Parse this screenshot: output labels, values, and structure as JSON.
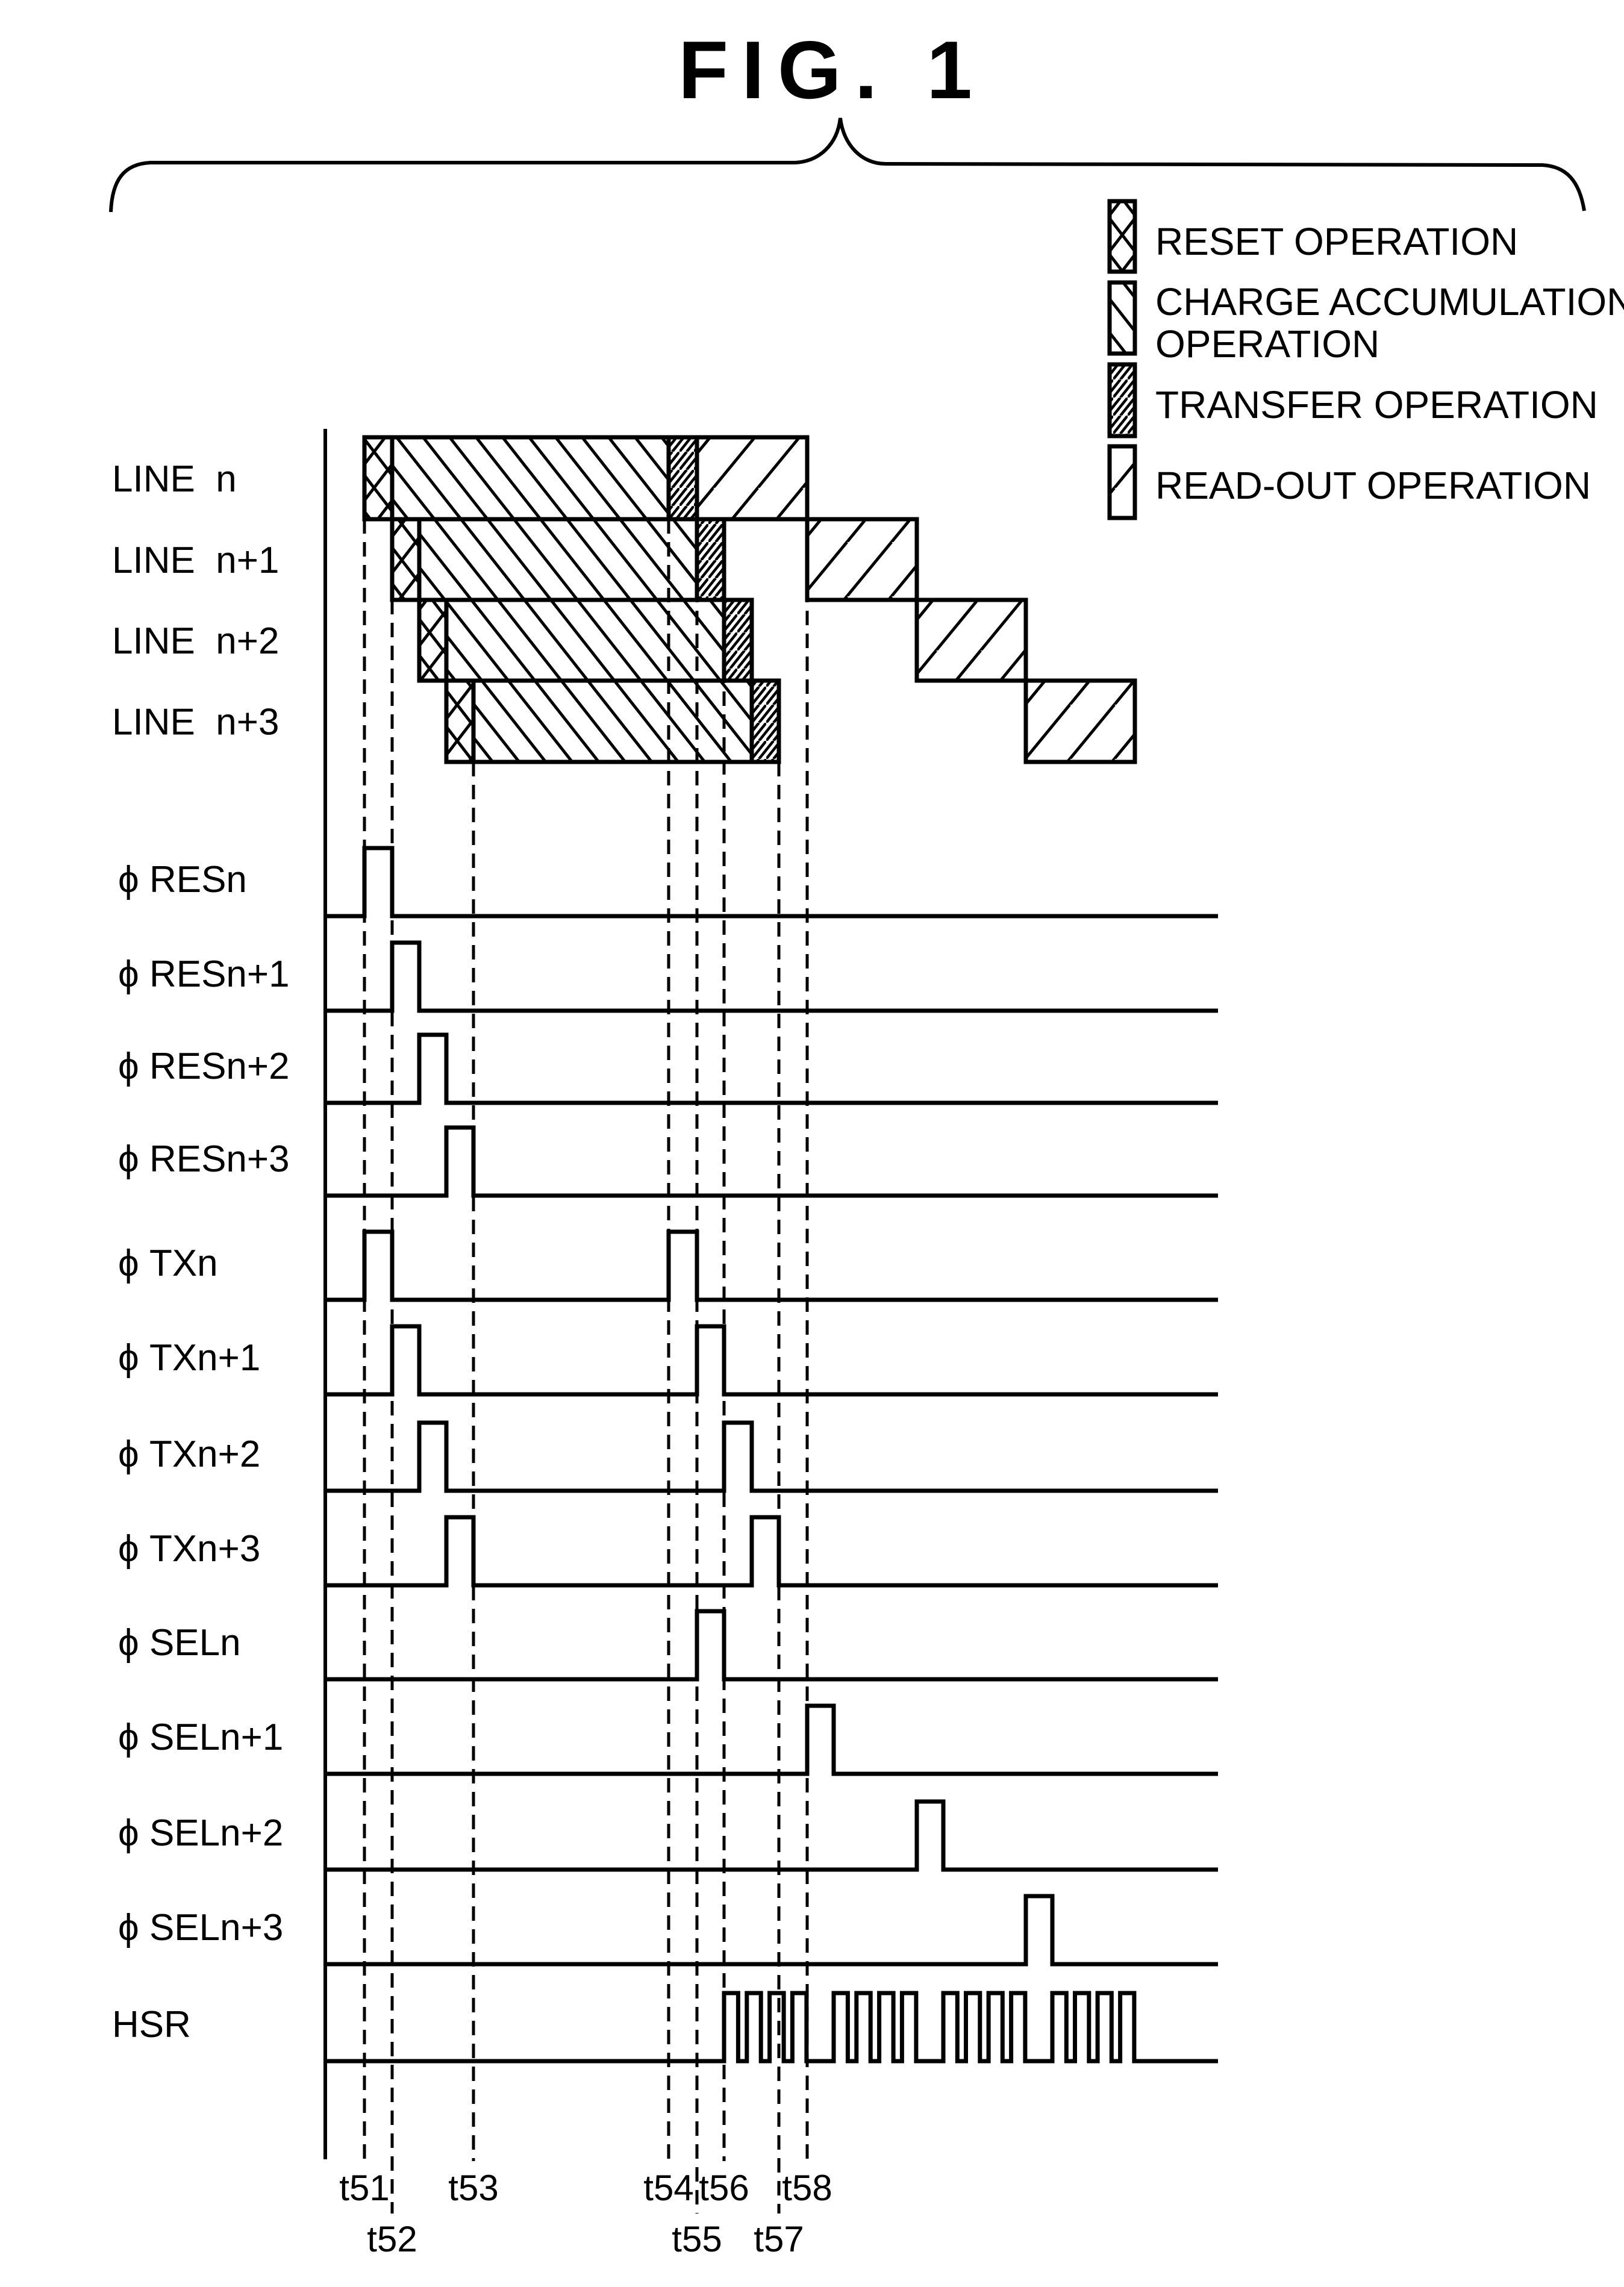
{
  "figure": {
    "title": "FIG. 1"
  },
  "legend": [
    {
      "key": "reset",
      "lines": [
        "RESET OPERATION"
      ],
      "pattern": "crosshatch"
    },
    {
      "key": "accumulation",
      "lines": [
        "CHARGE ACCUMULATION",
        "OPERATION"
      ],
      "pattern": "back-diagonal"
    },
    {
      "key": "transfer",
      "lines": [
        "TRANSFER OPERATION"
      ],
      "pattern": "dense-forward-diagonal"
    },
    {
      "key": "readout",
      "lines": [
        "READ-OUT OPERATION"
      ],
      "pattern": "forward-diagonal"
    }
  ],
  "time_marks": [
    {
      "label": "t51",
      "row": 1
    },
    {
      "label": "t52",
      "row": 2
    },
    {
      "label": "t53",
      "row": 1
    },
    {
      "label": "t54",
      "row": 1
    },
    {
      "label": "t55",
      "row": 2
    },
    {
      "label": "t56",
      "row": 1
    },
    {
      "label": "t57",
      "row": 2
    },
    {
      "label": "t58",
      "row": 1
    }
  ],
  "lines": [
    {
      "label": "LINE n",
      "segments": [
        {
          "op": "reset",
          "from": "t51",
          "to": "t52"
        },
        {
          "op": "accumulation",
          "from": "t52",
          "to": "t54"
        },
        {
          "op": "transfer",
          "from": "t54",
          "to": "t55"
        },
        {
          "op": "readout",
          "from": "t55",
          "to": "t58"
        }
      ]
    },
    {
      "label": "LINE n+1",
      "segments": [
        {
          "op": "reset",
          "from": "t52",
          "to": "t52+1"
        },
        {
          "op": "accumulation",
          "from": "t52+1",
          "to": "t55"
        },
        {
          "op": "transfer",
          "from": "t55",
          "to": "t56"
        },
        {
          "op": "readout",
          "from": "t58",
          "to": "R2"
        }
      ]
    },
    {
      "label": "LINE n+2",
      "segments": [
        {
          "op": "reset",
          "from": "t52+1",
          "to": "t52+2"
        },
        {
          "op": "accumulation",
          "from": "t52+2",
          "to": "t56"
        },
        {
          "op": "transfer",
          "from": "t56",
          "to": "t56+1"
        },
        {
          "op": "readout",
          "from": "R2",
          "to": "R3"
        }
      ]
    },
    {
      "label": "LINE n+3",
      "segments": [
        {
          "op": "reset",
          "from": "t52+2",
          "to": "t53"
        },
        {
          "op": "accumulation",
          "from": "t53",
          "to": "t56+1"
        },
        {
          "op": "transfer",
          "from": "t56+1",
          "to": "t57"
        },
        {
          "op": "readout",
          "from": "R3",
          "to": "R4"
        }
      ]
    }
  ],
  "signals": [
    {
      "label": "ϕ RESn",
      "pulses": [
        [
          "t51",
          "t52"
        ]
      ]
    },
    {
      "label": "ϕ RESn+1",
      "pulses": [
        [
          "t52",
          "t52+1"
        ]
      ]
    },
    {
      "label": "ϕ RESn+2",
      "pulses": [
        [
          "t52+1",
          "t52+2"
        ]
      ]
    },
    {
      "label": "ϕ RESn+3",
      "pulses": [
        [
          "t52+2",
          "t53"
        ]
      ]
    },
    {
      "label": "ϕ TXn",
      "pulses": [
        [
          "t51",
          "t52"
        ],
        [
          "t54",
          "t55"
        ]
      ]
    },
    {
      "label": "ϕ TXn+1",
      "pulses": [
        [
          "t52",
          "t52+1"
        ],
        [
          "t55",
          "t56"
        ]
      ]
    },
    {
      "label": "ϕ TXn+2",
      "pulses": [
        [
          "t52+1",
          "t52+2"
        ],
        [
          "t56",
          "t56+1"
        ]
      ]
    },
    {
      "label": "ϕ TXn+3",
      "pulses": [
        [
          "t52+2",
          "t53"
        ],
        [
          "t56+1",
          "t57"
        ]
      ]
    },
    {
      "label": "ϕ SELn",
      "pulses": [
        [
          "t55",
          "t56"
        ]
      ]
    },
    {
      "label": "ϕ SELn+1",
      "pulses": [
        [
          "t58",
          "t58+1"
        ]
      ]
    },
    {
      "label": "ϕ SELn+2",
      "pulses": [
        [
          "R2",
          "R2+1"
        ]
      ]
    },
    {
      "label": "ϕ SELn+3",
      "pulses": [
        [
          "R3",
          "R3+1"
        ]
      ]
    },
    {
      "label": "HSR",
      "bursts": [
        {
          "from": "t56",
          "to": "t58",
          "pulses": 4
        },
        {
          "from": "t58+1",
          "to": "R2",
          "pulses": 4
        },
        {
          "from": "R2+1",
          "to": "R3",
          "pulses": 4
        },
        {
          "from": "R3+1",
          "to": "R4",
          "pulses": 4
        }
      ]
    }
  ]
}
